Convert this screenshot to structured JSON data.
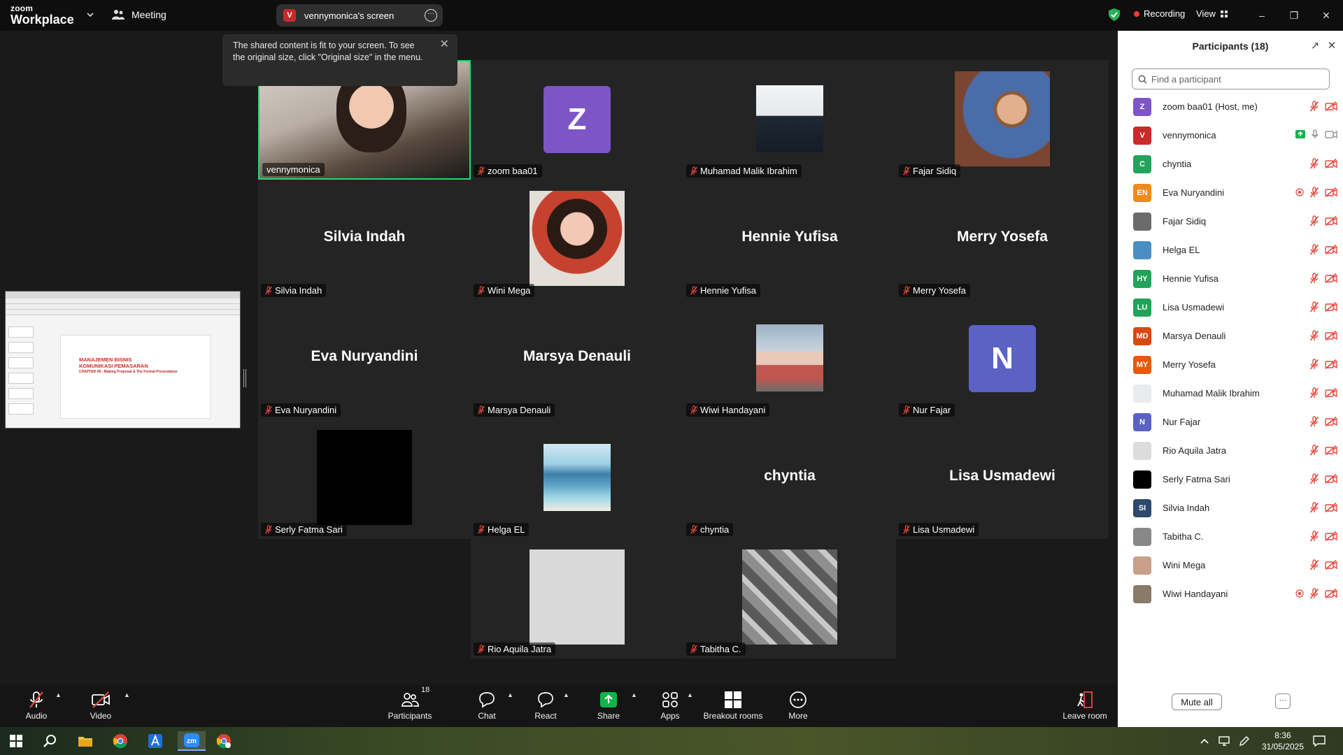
{
  "app": {
    "logo_top": "zoom",
    "logo_bottom": "Workplace",
    "meeting_label": "Meeting"
  },
  "share_pill": {
    "initial": "V",
    "title": "vennymonica's screen"
  },
  "titlebar": {
    "recording": "Recording",
    "view": "View"
  },
  "toast": {
    "text": "The shared content is fit to your screen. To see the original size, click \"Original size\" in the menu."
  },
  "shared_slide": {
    "title1": "MANAJEMEN BISNIS",
    "title2": "KOMUNIKASI PEMASARAN",
    "subtitle": "CHAPTER #8 - Making Proposal & The Formal Presentation"
  },
  "tiles": [
    {
      "name": "vennymonica",
      "type": "video",
      "active": true,
      "muted": false
    },
    {
      "name": "zoom baa01",
      "type": "initial",
      "initial": "Z",
      "color": "#7d55c7",
      "muted": true
    },
    {
      "name": "Muhamad Malik Ibrahim",
      "type": "photo",
      "muted": true
    },
    {
      "name": "Fajar Sidiq",
      "type": "photo",
      "muted": true
    },
    {
      "name": "Silvia Indah",
      "type": "text",
      "muted": true
    },
    {
      "name": "Wini Mega",
      "type": "photo",
      "muted": true
    },
    {
      "name": "Hennie Yufisa",
      "type": "text",
      "muted": true
    },
    {
      "name": "Merry Yosefa",
      "type": "text",
      "muted": true
    },
    {
      "name": "Eva Nuryandini",
      "type": "text",
      "muted": true
    },
    {
      "name": "Marsya Denauli",
      "type": "text",
      "muted": true
    },
    {
      "name": "Wiwi Handayani",
      "type": "photo",
      "muted": true
    },
    {
      "name": "Nur Fajar",
      "type": "initial",
      "initial": "N",
      "color": "#5b62c4",
      "muted": true
    },
    {
      "name": "Serly Fatma Sari",
      "type": "photo",
      "muted": true
    },
    {
      "name": "Helga EL",
      "type": "photo",
      "muted": true
    },
    {
      "name": "chyntia",
      "type": "text",
      "muted": true
    },
    {
      "name": "Lisa Usmadewi",
      "type": "text",
      "muted": true
    },
    {
      "name": "Rio Aquila Jatra",
      "type": "photo",
      "muted": true
    },
    {
      "name": "Tabitha C.",
      "type": "photo",
      "muted": true
    }
  ],
  "panel": {
    "title": "Participants (18)",
    "search_placeholder": "Find a participant",
    "mute_all": "Mute all",
    "participants": [
      {
        "name": "zoom baa01 (Host, me)",
        "initials": "Z",
        "color": "#7d55c7"
      },
      {
        "name": "vennymonica",
        "initials": "V",
        "color": "#c92a2a",
        "sharing": true
      },
      {
        "name": "chyntia",
        "initials": "C",
        "color": "#22a35a"
      },
      {
        "name": "Eva Nuryandini",
        "initials": "EN",
        "color": "#f08a1c",
        "raised": true
      },
      {
        "name": "Fajar Sidiq",
        "initials": "",
        "color": "#6b6b6b"
      },
      {
        "name": "Helga EL",
        "initials": "",
        "color": "#4a8ec2"
      },
      {
        "name": "Hennie Yufisa",
        "initials": "HY",
        "color": "#22a35a"
      },
      {
        "name": "Lisa Usmadewi",
        "initials": "LU",
        "color": "#22a35a"
      },
      {
        "name": "Marsya Denauli",
        "initials": "MD",
        "color": "#d9480f"
      },
      {
        "name": "Merry Yosefa",
        "initials": "MY",
        "color": "#e8590c"
      },
      {
        "name": "Muhamad Malik Ibrahim",
        "initials": "",
        "color": "#e9ecef"
      },
      {
        "name": "Nur Fajar",
        "initials": "N",
        "color": "#5b62c4"
      },
      {
        "name": "Rio Aquila Jatra",
        "initials": "",
        "color": "#dcdcdc"
      },
      {
        "name": "Serly Fatma Sari",
        "initials": "",
        "color": "#000000"
      },
      {
        "name": "Silvia Indah",
        "initials": "SI",
        "color": "#2d4a6e"
      },
      {
        "name": "Tabitha C.",
        "initials": "",
        "color": "#888888"
      },
      {
        "name": "Wini Mega",
        "initials": "",
        "color": "#c9a08a"
      },
      {
        "name": "Wiwi Handayani",
        "initials": "",
        "color": "#8a7a6a",
        "raised": true
      }
    ]
  },
  "toolbar": {
    "audio": "Audio",
    "video": "Video",
    "participants": "Participants",
    "participants_count": "18",
    "chat": "Chat",
    "react": "React",
    "share": "Share",
    "apps": "Apps",
    "breakout": "Breakout rooms",
    "more": "More",
    "leave": "Leave room"
  },
  "taskbar": {
    "time": "8:36",
    "date": "31/05/2025"
  },
  "colors": {
    "active_speaker": "#23d96c",
    "muted_red": "#e8453c",
    "share_green": "#12b34a"
  }
}
